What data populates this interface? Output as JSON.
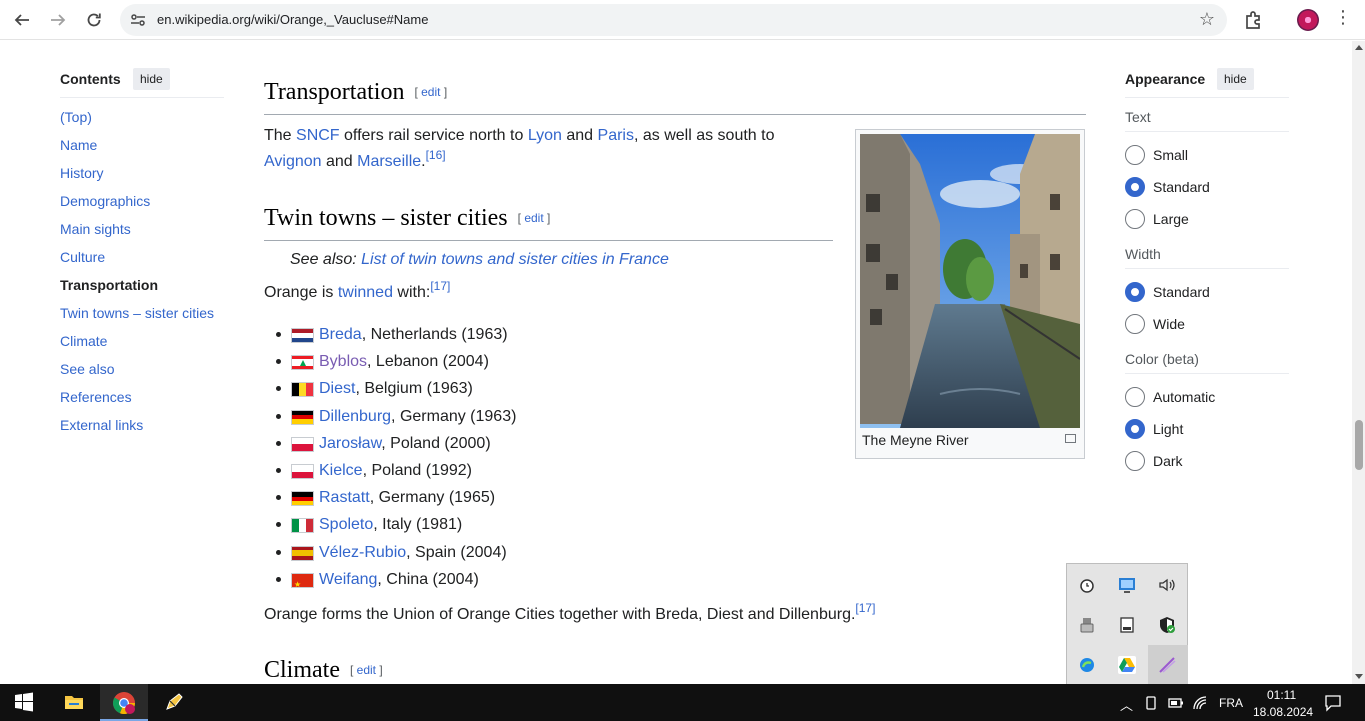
{
  "browser": {
    "url": "en.wikipedia.org/wiki/Orange,_Vaucluse#Name"
  },
  "toc": {
    "title": "Contents",
    "hide_label": "hide",
    "items": [
      "(Top)",
      "Name",
      "History",
      "Demographics",
      "Main sights",
      "Culture",
      "Transportation",
      "Twin towns – sister cities",
      "Climate",
      "See also",
      "References",
      "External links"
    ],
    "active": "Transportation"
  },
  "transportation": {
    "heading": "Transportation",
    "edit": "edit",
    "t1": "The ",
    "l_sncf": "SNCF",
    "t2": " offers rail service north to ",
    "l_lyon": "Lyon",
    "t3": " and ",
    "l_paris": "Paris",
    "t4": ", as well as south to",
    "l_avignon": "Avignon",
    "t5": " and ",
    "l_marseille": "Marseille",
    "t6": ".",
    "ref": "[16]"
  },
  "twin": {
    "heading": "Twin towns – sister cities",
    "edit": "edit",
    "see_also_prefix": "See also: ",
    "see_also_link": "List of twin towns and sister cities in France",
    "intro1": "Orange is ",
    "intro_link": "twinned",
    "intro2": " with:",
    "intro_ref": "[17]",
    "towns": [
      {
        "city": "Breda",
        "rest": ", Netherlands (1963)",
        "flag": "nl"
      },
      {
        "city": "Byblos",
        "rest": ", Lebanon (2004)",
        "flag": "lb"
      },
      {
        "city": "Diest",
        "rest": ", Belgium (1963)",
        "flag": "be"
      },
      {
        "city": "Dillenburg",
        "rest": ", Germany (1963)",
        "flag": "de"
      },
      {
        "city": "Jarosław",
        "rest": ", Poland (2000)",
        "flag": "pl"
      },
      {
        "city": "Kielce",
        "rest": ", Poland (1992)",
        "flag": "pl"
      },
      {
        "city": "Rastatt",
        "rest": ", Germany (1965)",
        "flag": "de"
      },
      {
        "city": "Spoleto",
        "rest": ", Italy (1981)",
        "flag": "it"
      },
      {
        "city": "Vélez-Rubio",
        "rest": ", Spain (2004)",
        "flag": "es"
      },
      {
        "city": "Weifang",
        "rest": ", China (2004)",
        "flag": "cn"
      }
    ],
    "union_text": "Orange forms the Union of Orange Cities together with Breda, Diest and Dillenburg.",
    "union_ref": "[17]"
  },
  "climate": {
    "heading": "Climate",
    "edit": "edit"
  },
  "image": {
    "caption": "The Meyne River"
  },
  "appearance": {
    "title": "Appearance",
    "hide_label": "hide",
    "text_label": "Text",
    "text_options": [
      "Small",
      "Standard",
      "Large"
    ],
    "text_selected": "Standard",
    "width_label": "Width",
    "width_options": [
      "Standard",
      "Wide"
    ],
    "width_selected": "Standard",
    "color_label": "Color (beta)",
    "color_options": [
      "Automatic",
      "Light",
      "Dark"
    ],
    "color_selected": "Light"
  },
  "taskbar": {
    "lang": "FRA",
    "time": "01:11",
    "date": "18.08.2024"
  }
}
